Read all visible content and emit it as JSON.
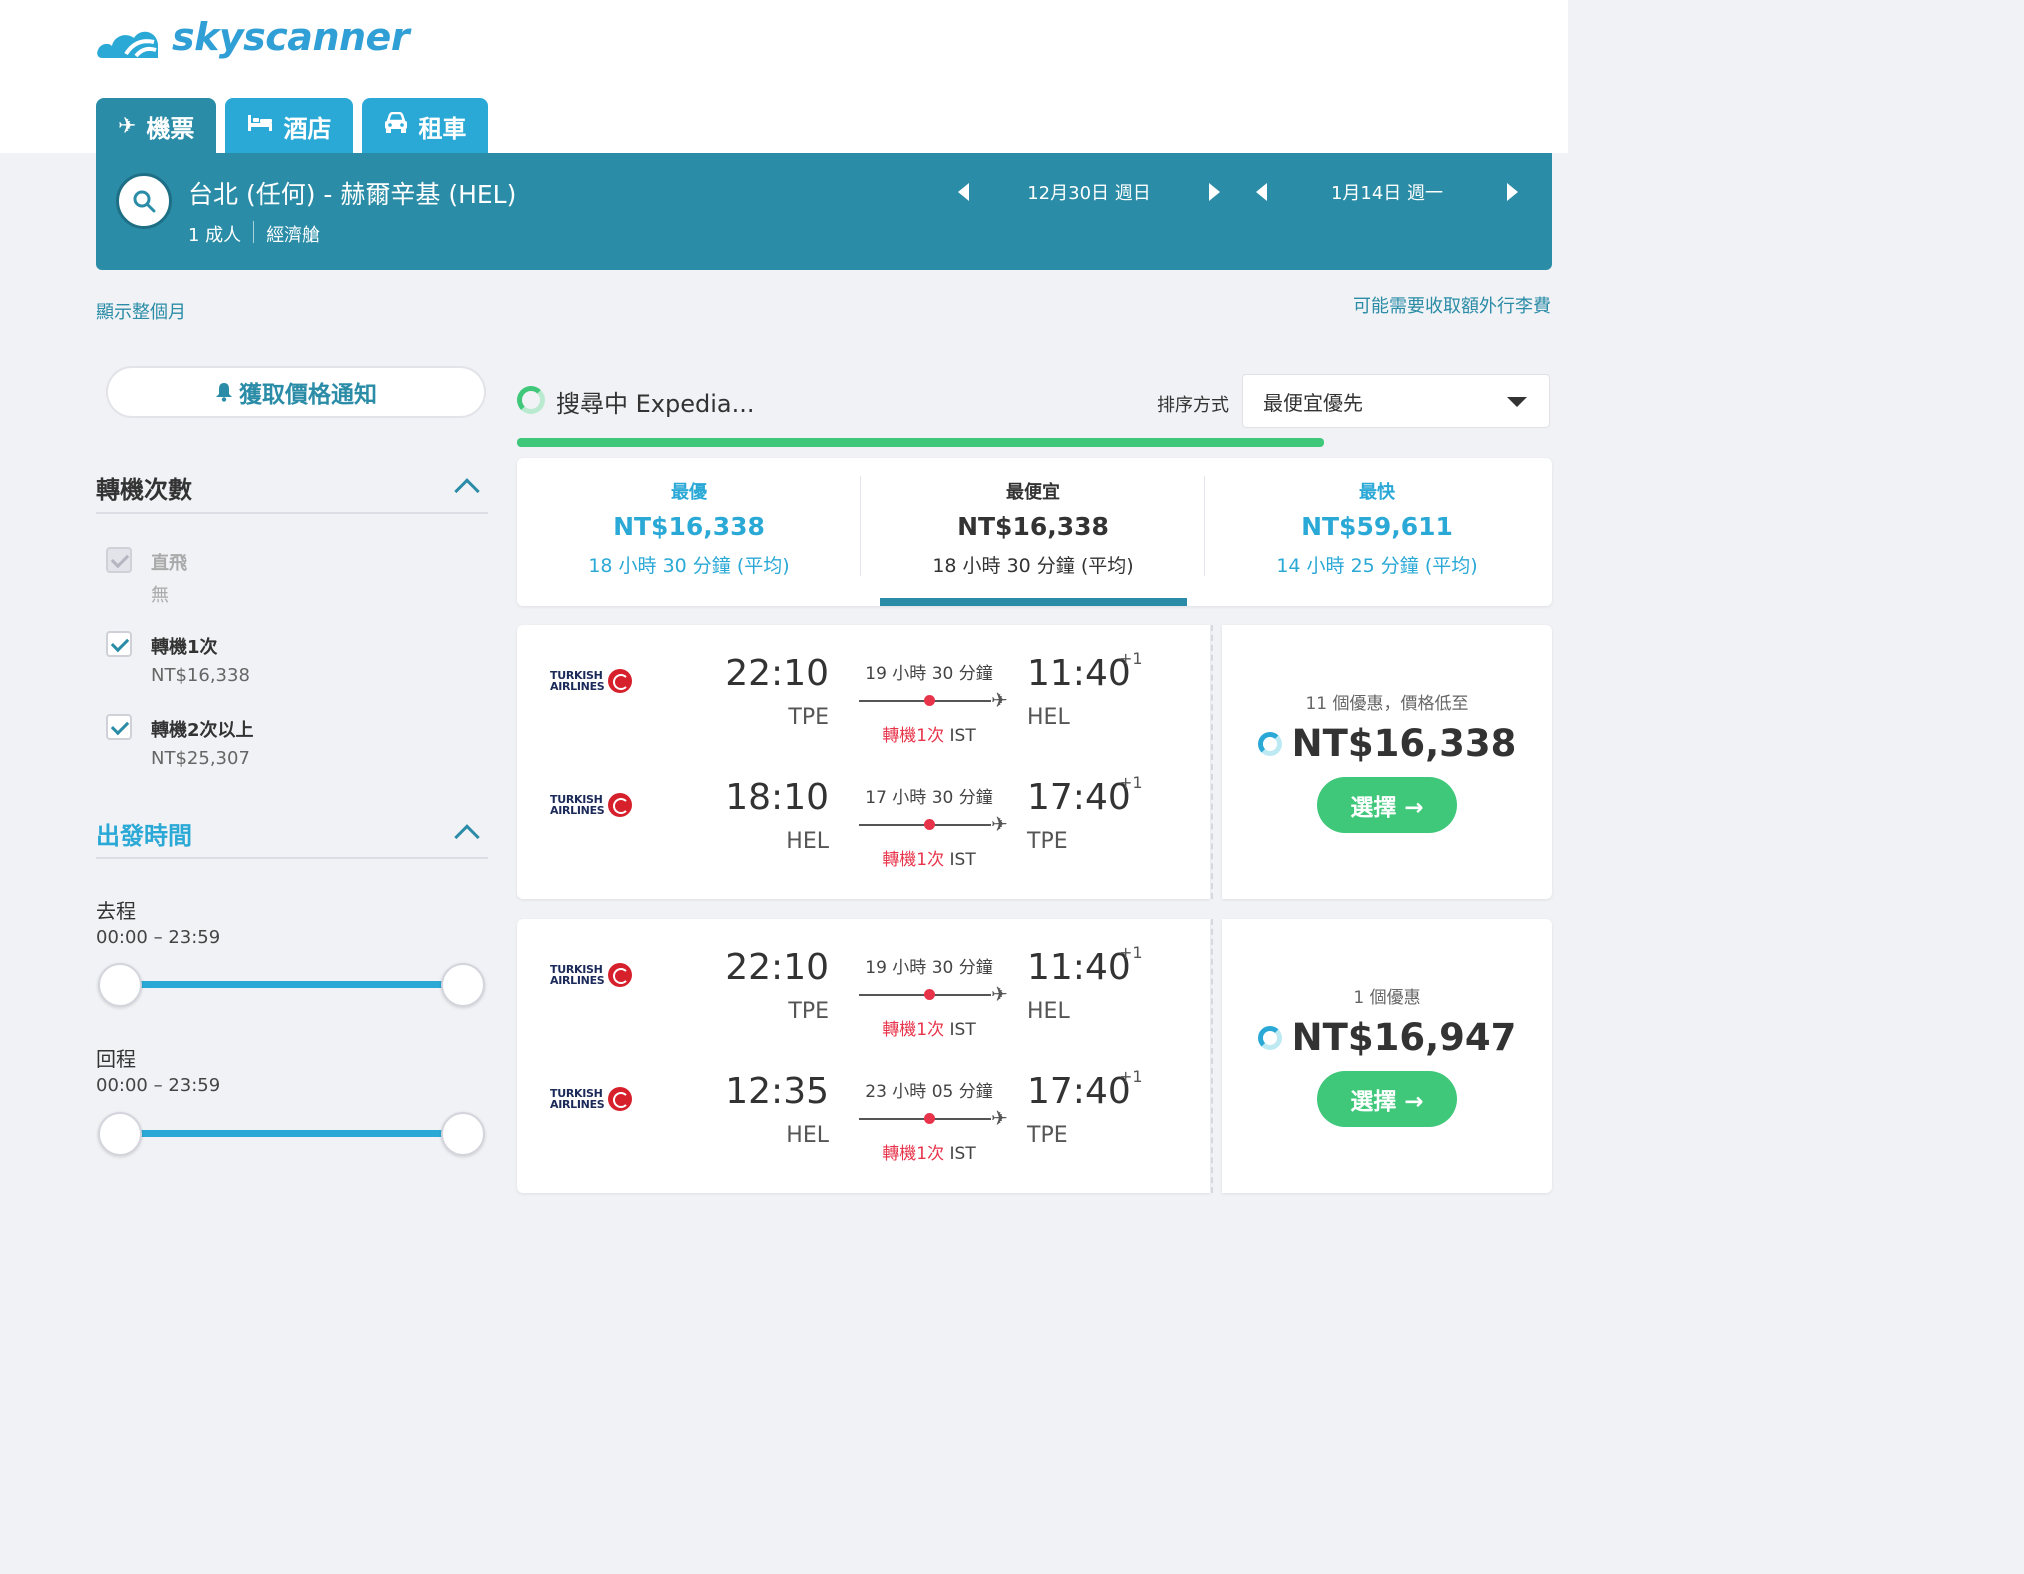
{
  "brand": {
    "name": "skyscanner"
  },
  "tabs": [
    {
      "label": "機票",
      "icon": "plane-icon",
      "glyph": "✈"
    },
    {
      "label": "酒店",
      "icon": "bed-icon",
      "glyph": "🛏"
    },
    {
      "label": "租車",
      "icon": "car-icon",
      "glyph": "🚘"
    }
  ],
  "search": {
    "route": "台北 (任何) - 赫爾辛基 (HEL)",
    "passengers": "1 成人",
    "cabin": "經濟艙",
    "depart_date": "12月30日 週日",
    "return_date": "1月14日 週一"
  },
  "links": {
    "show_month": "顯示整個月",
    "baggage_fee": "可能需要收取額外行李費"
  },
  "alert_button": "獲取價格通知",
  "filters": {
    "stops_title": "轉機次數",
    "options": [
      {
        "label": "直飛",
        "sub": "無",
        "checked": true,
        "disabled": true
      },
      {
        "label": "轉機1次",
        "sub": "NT$16,338",
        "checked": true,
        "disabled": false
      },
      {
        "label": "轉機2次以上",
        "sub": "NT$25,307",
        "checked": true,
        "disabled": false
      }
    ],
    "departure_title": "出發時間",
    "outbound_label": "去程",
    "outbound_range": "00:00 – 23:59",
    "return_label": "回程",
    "return_range": "00:00 – 23:59"
  },
  "results_header": {
    "searching": "搜尋中 Expedia...",
    "sort_label": "排序方式",
    "sort_value": "最便宜優先",
    "progress": 0.78
  },
  "summary": [
    {
      "title": "最優",
      "price": "NT$16,338",
      "duration": "18 小時 30 分鐘 (平均)",
      "style": "blue"
    },
    {
      "title": "最便宜",
      "price": "NT$16,338",
      "duration": "18 小時 30 分鐘 (平均)",
      "style": "dark"
    },
    {
      "title": "最快",
      "price": "NT$59,611",
      "duration": "14 小時 25 分鐘 (平均)",
      "style": "blue"
    }
  ],
  "results": [
    {
      "legs": [
        {
          "airline": "TURKISH AIRLINES",
          "dep_time": "22:10",
          "dep_code": "TPE",
          "duration": "19 小時 30 分鐘",
          "stops": "轉機1次",
          "via": "IST",
          "arr_time": "11:40",
          "arr_code": "HEL",
          "day_offset": "+1"
        },
        {
          "airline": "TURKISH AIRLINES",
          "dep_time": "18:10",
          "dep_code": "HEL",
          "duration": "17 小時 30 分鐘",
          "stops": "轉機1次",
          "via": "IST",
          "arr_time": "17:40",
          "arr_code": "TPE",
          "day_offset": "+1"
        }
      ],
      "deals": "11 個優惠，價格低至",
      "price": "NT$16,338",
      "select": "選擇 →"
    },
    {
      "legs": [
        {
          "airline": "TURKISH AIRLINES",
          "dep_time": "22:10",
          "dep_code": "TPE",
          "duration": "19 小時 30 分鐘",
          "stops": "轉機1次",
          "via": "IST",
          "arr_time": "11:40",
          "arr_code": "HEL",
          "day_offset": "+1"
        },
        {
          "airline": "TURKISH AIRLINES",
          "dep_time": "12:35",
          "dep_code": "HEL",
          "duration": "23 小時 05 分鐘",
          "stops": "轉機1次",
          "via": "IST",
          "arr_time": "17:40",
          "arr_code": "TPE",
          "day_offset": "+1"
        }
      ],
      "deals": "1 個優惠",
      "price": "NT$16,947",
      "select": "選擇 →"
    }
  ],
  "colors": {
    "brand_teal": "#2a8ca6",
    "tab_blue": "#2ba9d6",
    "green": "#3fc77a",
    "stop_red": "#e7344b"
  }
}
